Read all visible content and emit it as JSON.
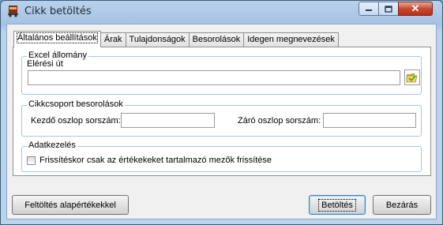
{
  "window": {
    "title": "Cikk betöltés",
    "controls": {
      "minimize": "minimize-icon",
      "maximize": "maximize-icon",
      "close": "close-icon"
    }
  },
  "tabs": [
    {
      "label": "Általános beállítások",
      "active": true
    },
    {
      "label": "Árak",
      "active": false
    },
    {
      "label": "Tulajdonságok",
      "active": false
    },
    {
      "label": "Besorolások",
      "active": false
    },
    {
      "label": "Idegen megnevezések",
      "active": false
    }
  ],
  "excel": {
    "legend": "Excel állomány",
    "path_label": "Elérési út",
    "path_value": "",
    "browse_icon": "folder-open-icon"
  },
  "group_class": {
    "legend": "Cikkcsoport besorolások",
    "start_label": "Kezdő oszlop sorszám:",
    "start_value": "",
    "end_label": "Záró oszlop sorszám:",
    "end_value": ""
  },
  "data_handling": {
    "legend": "Adatkezelés",
    "checkbox_label": "Frissítéskor csak az értékekeket tartalmazó mezők frissítése",
    "checked": false
  },
  "buttons": {
    "defaults": "Feltöltés alapértékekkel",
    "load": "Betöltés",
    "close": "Bezárás"
  }
}
